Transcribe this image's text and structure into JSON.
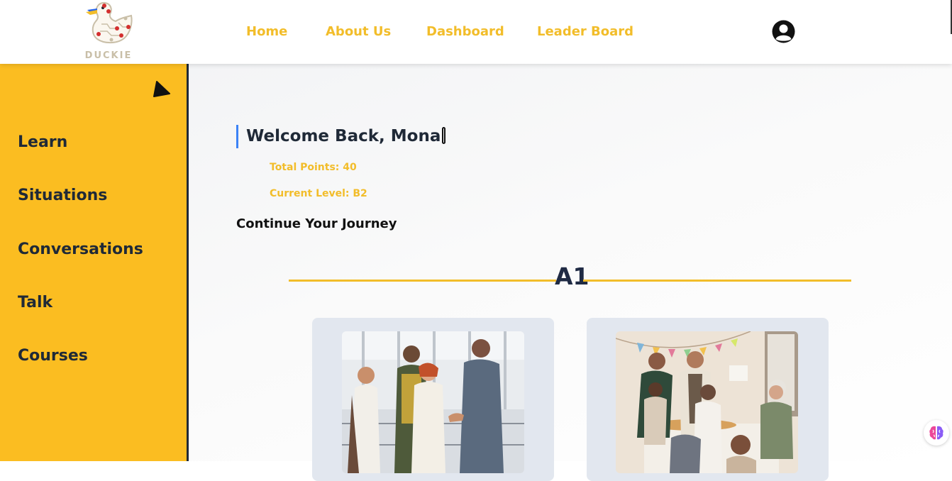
{
  "header": {
    "logo_text": "DUCKIE",
    "nav": [
      {
        "label": "Home"
      },
      {
        "label": "About Us"
      },
      {
        "label": "Dashboard"
      },
      {
        "label": "Leader Board"
      }
    ],
    "profile_icon": "user-circle-icon"
  },
  "sidebar": {
    "toggle_icon": "triangle-collapse-icon",
    "items": [
      {
        "label": "Learn"
      },
      {
        "label": "Situations"
      },
      {
        "label": "Conversations"
      },
      {
        "label": "Talk"
      },
      {
        "label": "Courses"
      }
    ]
  },
  "main": {
    "welcome": "Welcome Back, Mona",
    "total_points": "Total Points: 40",
    "current_level": "Current Level: B2",
    "continue_heading": "Continue Your Journey",
    "level_title": "A1",
    "cards": [
      {
        "image": "group-greeting-photo"
      },
      {
        "image": "dinner-party-photo"
      }
    ]
  },
  "floating_button": {
    "icon": "brain-icon"
  },
  "colors": {
    "accent_yellow": "#fbbd21",
    "nav_text": "#f2bd2a",
    "dark_text": "#1f2937",
    "welcome_border": "#3b82f6",
    "card_bg": "#e2e7ef"
  }
}
